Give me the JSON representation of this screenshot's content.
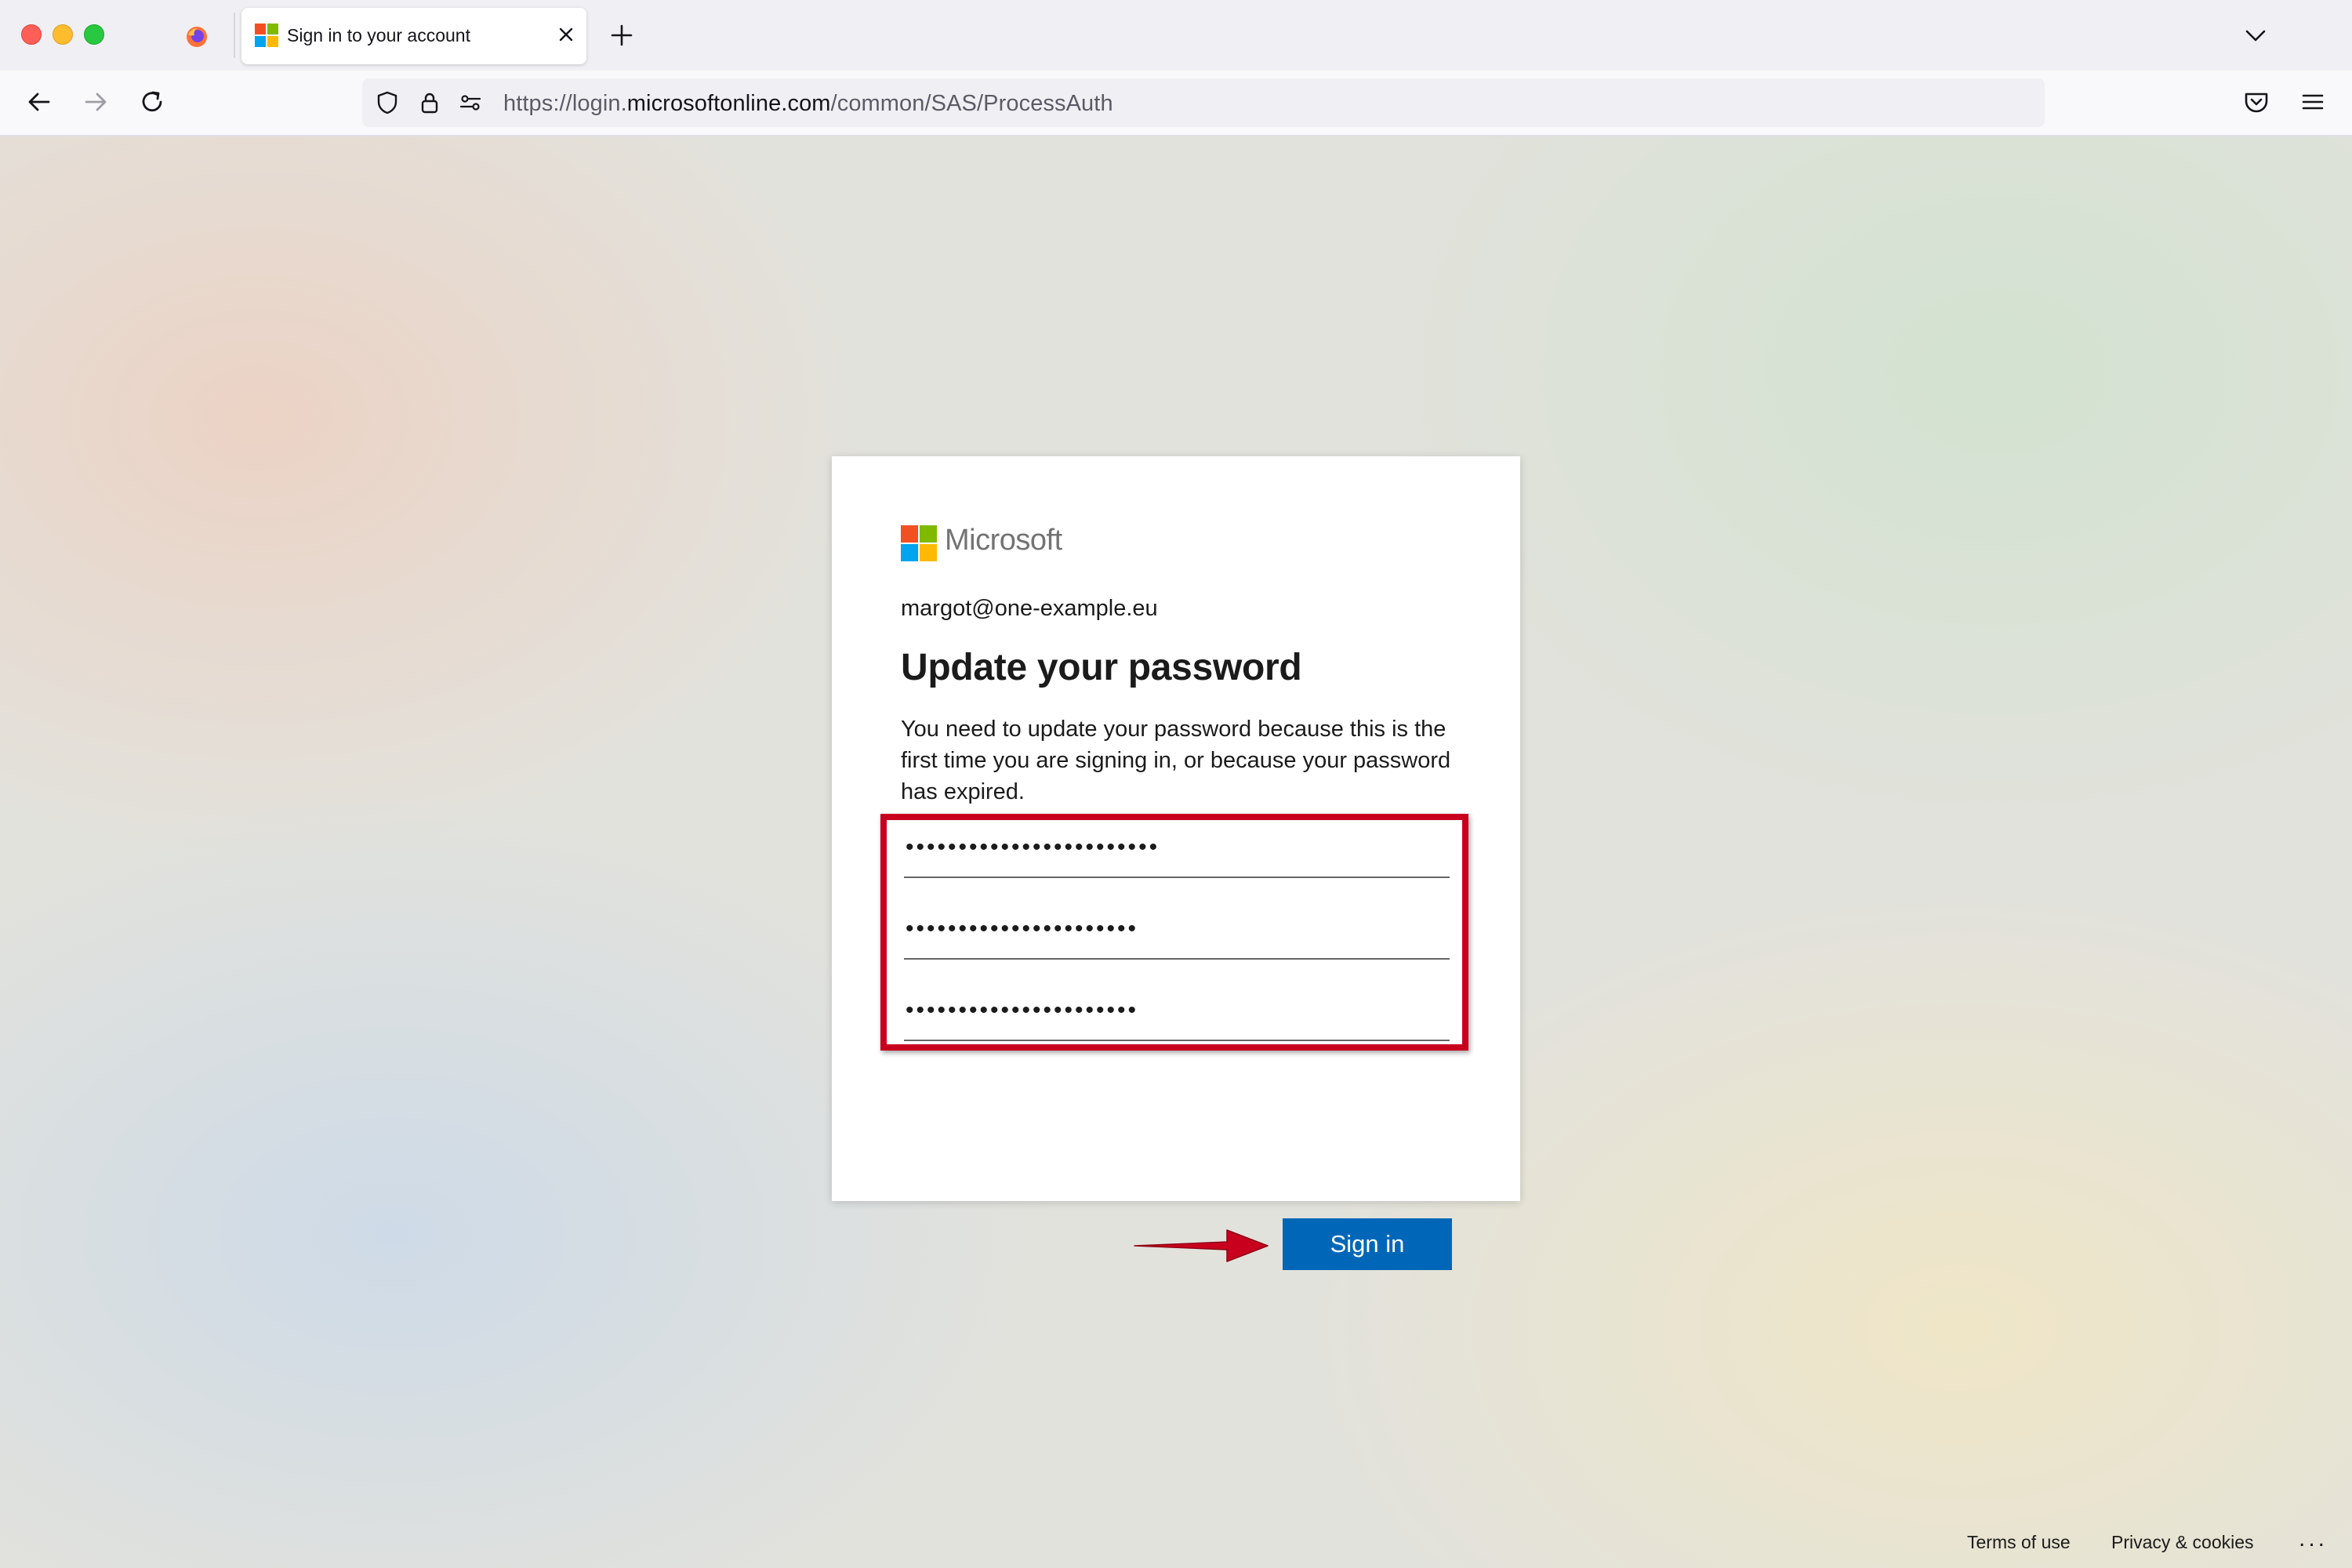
{
  "browser": {
    "tab": {
      "title": "Sign in to your account"
    },
    "url": {
      "prefix": "https://login.",
      "host": "microsoftonline.com",
      "path": "/common/SAS/ProcessAuth"
    },
    "icons": {
      "back": "arrow-left-icon",
      "forward": "arrow-right-icon",
      "reload": "reload-icon",
      "shield": "tracking-protection-shield-icon",
      "lock": "lock-icon",
      "permissions": "permissions-icon",
      "bookmark": "star-icon",
      "pocket": "pocket-icon",
      "menu": "hamburger-menu-icon",
      "new_tab": "plus-icon",
      "tab_list": "chevron-down-icon",
      "tab_close": "close-icon"
    }
  },
  "signin": {
    "brand": "Microsoft",
    "email": "margot@one-example.eu",
    "heading": "Update your password",
    "description": "You need to update your password because this is the first time you are signing in, or because your password has expired.",
    "fields": [
      {
        "value": "••••••••••••••••••••••••"
      },
      {
        "value": "••••••••••••••••••••••"
      },
      {
        "value": "••••••••••••••••••••••"
      }
    ],
    "submit_label": "Sign in"
  },
  "footer": {
    "terms": "Terms of use",
    "privacy": "Privacy & cookies",
    "more": "..."
  },
  "colors": {
    "ms_red": "#f25022",
    "ms_green": "#7fba00",
    "ms_blue": "#00a4ef",
    "ms_yellow": "#ffb900",
    "button_blue": "#0067b8",
    "annotation_red": "#c8001e"
  }
}
